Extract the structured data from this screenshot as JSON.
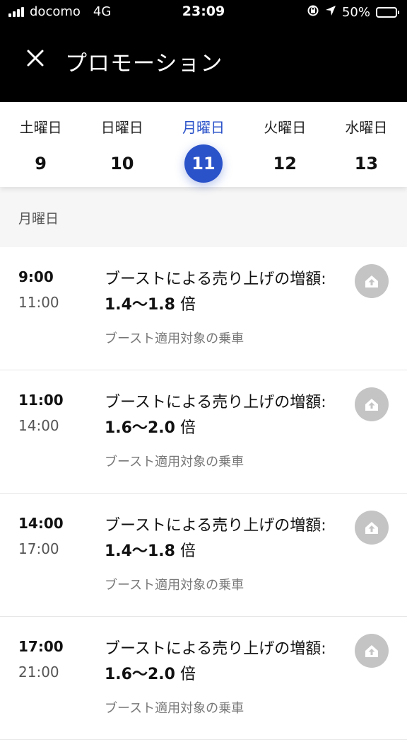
{
  "status_bar": {
    "carrier": "docomo",
    "network": "4G",
    "time": "23:09",
    "battery": "50%",
    "battery_level": 0.5
  },
  "header": {
    "title": "プロモーション",
    "close_icon": "close-icon"
  },
  "days": [
    {
      "name": "土曜日",
      "num": "9",
      "selected": false
    },
    {
      "name": "日曜日",
      "num": "10",
      "selected": false
    },
    {
      "name": "月曜日",
      "num": "11",
      "selected": true
    },
    {
      "name": "火曜日",
      "num": "12",
      "selected": false
    },
    {
      "name": "水曜日",
      "num": "13",
      "selected": false
    }
  ],
  "section_title": "月曜日",
  "promotions": [
    {
      "start": "9:00",
      "end": "11:00",
      "desc_prefix": "ブーストによる売り上げの増額: ",
      "multiplier": "1.4〜1.8",
      "desc_suffix": " 倍",
      "sub": "ブースト適用対象の乗車"
    },
    {
      "start": "11:00",
      "end": "14:00",
      "desc_prefix": "ブーストによる売り上げの増額: ",
      "multiplier": "1.6〜2.0",
      "desc_suffix": " 倍",
      "sub": "ブースト適用対象の乗車"
    },
    {
      "start": "14:00",
      "end": "17:00",
      "desc_prefix": "ブーストによる売り上げの増額: ",
      "multiplier": "1.4〜1.8",
      "desc_suffix": " 倍",
      "sub": "ブースト適用対象の乗車"
    },
    {
      "start": "17:00",
      "end": "21:00",
      "desc_prefix": "ブーストによる売り上げの増額: ",
      "multiplier": "1.6〜2.0",
      "desc_suffix": " 倍",
      "sub": "ブースト適用対象の乗車"
    }
  ],
  "colors": {
    "accent": "#2a52c9",
    "header_bg": "#000000",
    "boost_icon_bg": "#c4c4c4"
  }
}
